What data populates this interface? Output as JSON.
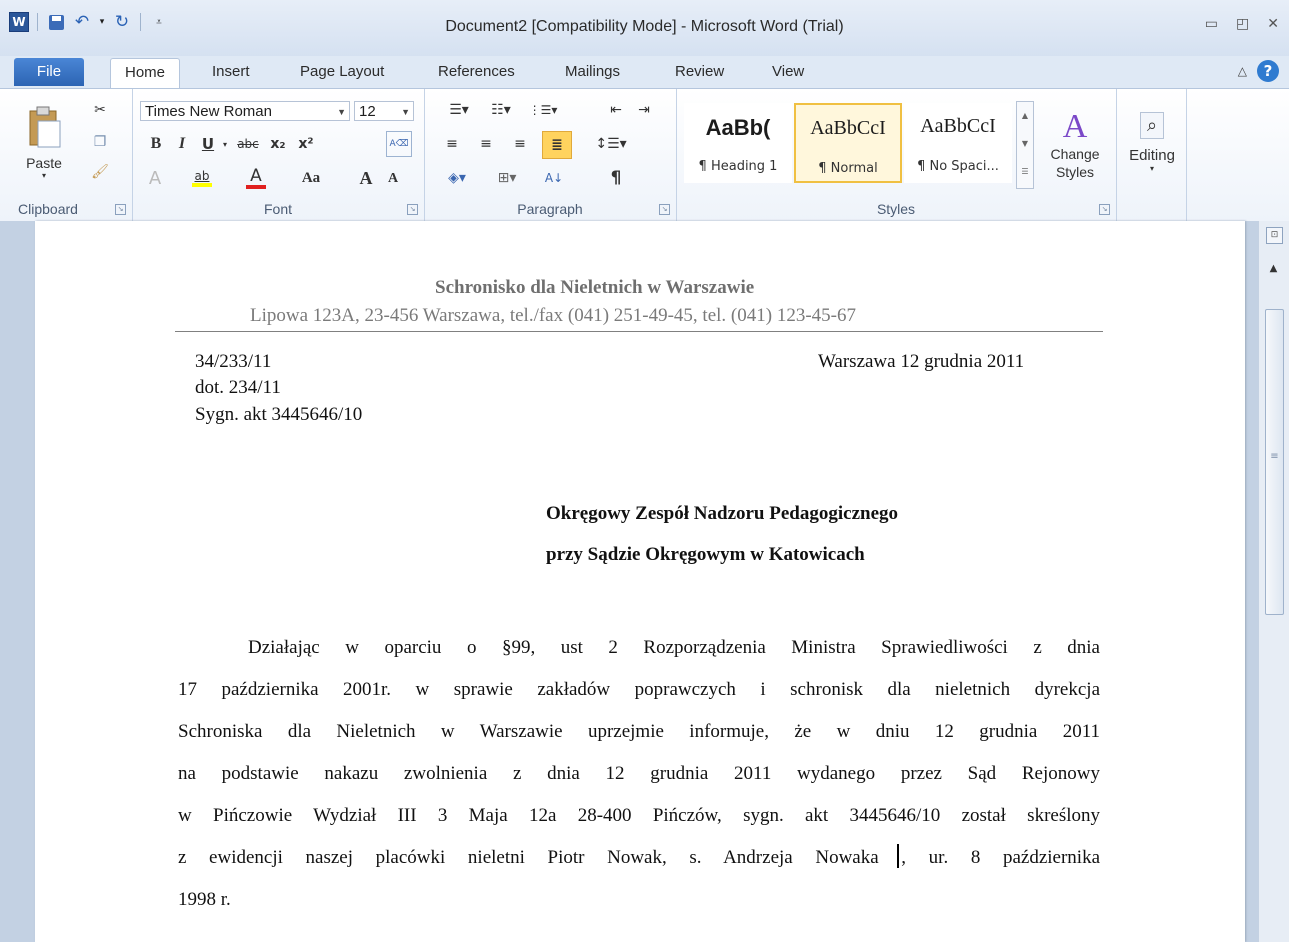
{
  "app": {
    "title": "Document2 [Compatibility Mode] - Microsoft Word (Trial)",
    "logo_letter": "W"
  },
  "window_controls": {
    "minimize": "▭",
    "restore": "◰",
    "close": "✕"
  },
  "tabs": [
    {
      "label": "File"
    },
    {
      "label": "Home"
    },
    {
      "label": "Insert"
    },
    {
      "label": "Page Layout"
    },
    {
      "label": "References"
    },
    {
      "label": "Mailings"
    },
    {
      "label": "Review"
    },
    {
      "label": "View"
    }
  ],
  "ribbon": {
    "clipboard": {
      "paste": "Paste",
      "label": "Clipboard"
    },
    "font": {
      "name": "Times New Roman",
      "size": "12",
      "bold": "B",
      "italic": "I",
      "underline": "U",
      "strikethrough": "abc",
      "subscript": "x₂",
      "superscript": "x²",
      "grow": "A",
      "shrink": "A",
      "change_case": "Aa",
      "label": "Font"
    },
    "paragraph": {
      "label": "Paragraph",
      "pilcrow": "¶"
    },
    "styles": {
      "items": [
        {
          "preview": "AaBb(",
          "name": "¶ Heading 1"
        },
        {
          "preview": "AaBbCcI",
          "name": "¶ Normal"
        },
        {
          "preview": "AaBbCcI",
          "name": "¶ No Spaci..."
        }
      ],
      "change_styles": "Change Styles",
      "label": "Styles"
    },
    "editing": {
      "label": "Editing"
    }
  },
  "document": {
    "header_name": "Schronisko dla Nieletnich w Warszawie",
    "header_address": "Lipowa 123A, 23-456 Warszawa, tel./fax (041) 251-49-45, tel. (041) 123-45-67",
    "ref_lines": [
      "34/233/11",
      "dot. 234/11",
      "Sygn. akt 3445646/10"
    ],
    "date": "Warszawa 12 grudnia 2011",
    "addressee": [
      "Okręgowy Zespół Nadzoru Pedagogicznego",
      "przy Sądzie Okręgowym w Katowicach"
    ],
    "body_lines": [
      "Działając w oparciu o §99, ust 2 Rozporządzenia Ministra Sprawiedliwości z dnia",
      "17 października 2001r. w sprawie zakładów poprawczych i schronisk dla nieletnich dyrekcja",
      "Schroniska dla Nieletnich w Warszawie uprzejmie informuje, że w dniu 12 grudnia 2011",
      "na podstawie nakazu zwolnienia z dnia 12 grudnia 2011 wydanego przez Sąd Rejonowy",
      "w Pińczowie Wydział III 3 Maja 12a 28-400 Pińczów, sygn. akt 3445646/10 został skreślony",
      "z ewidencji naszej placówki nieletni Piotr Nowak, s. Andrzeja Nowaka , ur. 8 października",
      "1998 r."
    ]
  }
}
